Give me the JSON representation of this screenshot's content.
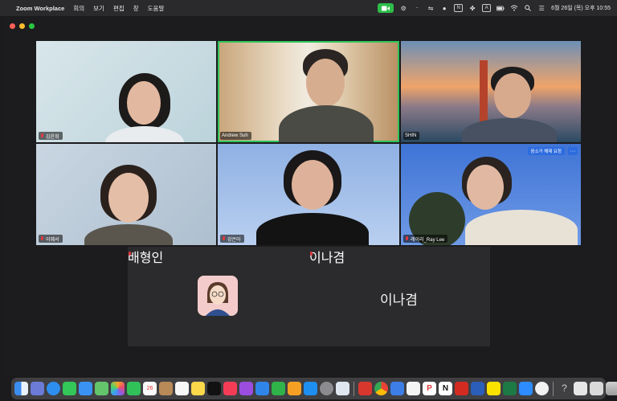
{
  "menubar": {
    "app_name": "Zoom Workplace",
    "menus": [
      "회의",
      "보기",
      "편집",
      "창",
      "도움말"
    ],
    "clock": "6월 26일 (목) 오후 10:55"
  },
  "participants": {
    "p1": "김윤희",
    "p2": "Andrew Suh",
    "p3": "SHIN",
    "p4": "이혜서",
    "p5": "강은아",
    "p6": "레이리_Ray Lee",
    "p7": "배형인",
    "p8": "이나겸",
    "p8_big": "이나겸"
  },
  "tile_actions": {
    "request_label": "음소거 해제 요청",
    "more_label": "···"
  },
  "dock": {
    "trash_label": "Trash"
  },
  "colors": {
    "speaker_highlight": "#2fc35a",
    "muted_mic": "#e0383e",
    "zoom_status": "#2fbd4a"
  }
}
